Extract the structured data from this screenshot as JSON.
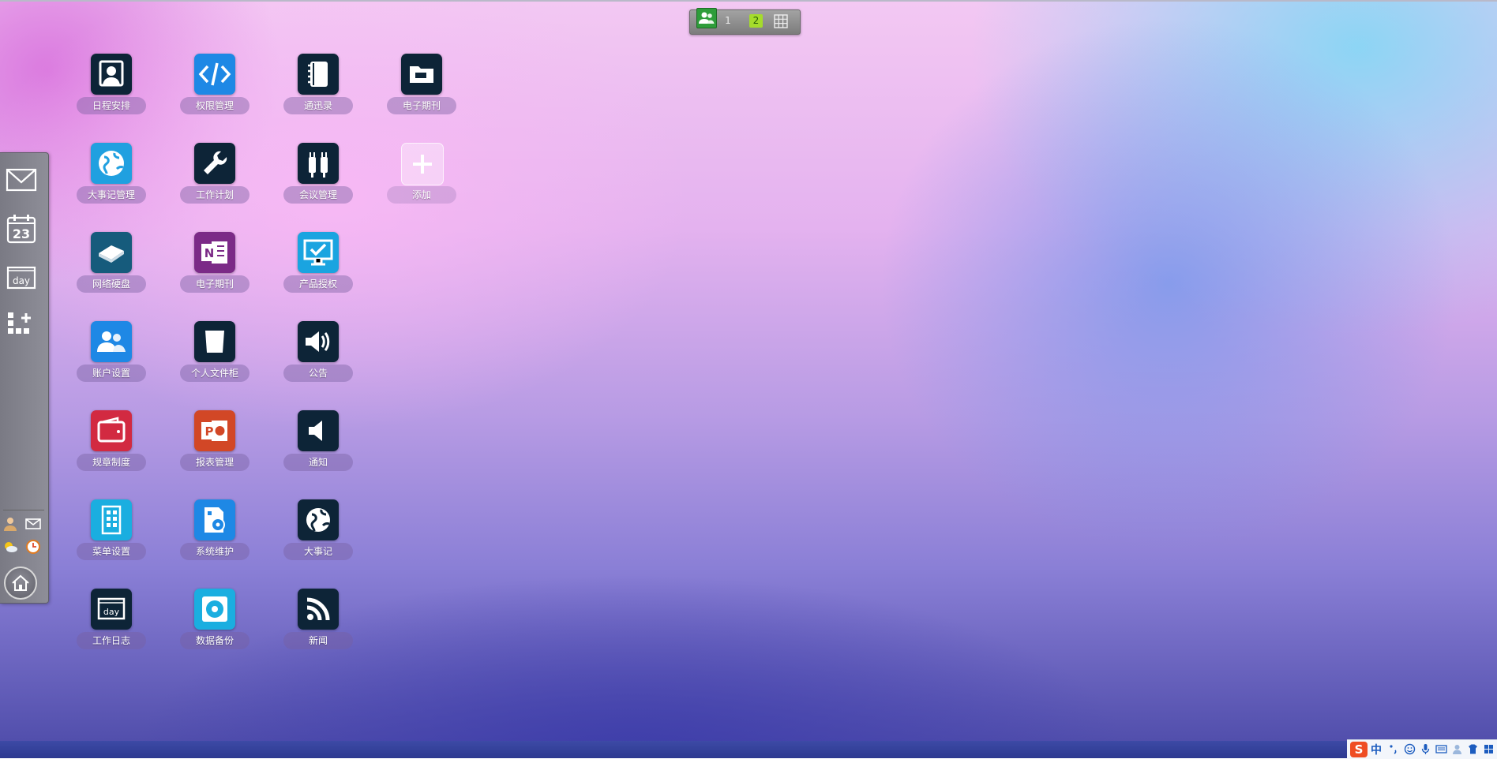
{
  "switcher": {
    "pages": [
      "1",
      "2"
    ],
    "active_page": "2"
  },
  "apps": [
    {
      "label": "日程安排",
      "icon": "schedule-icon",
      "color": "#0d2437"
    },
    {
      "label": "权限管理",
      "icon": "code-icon",
      "color": "#1e88e5"
    },
    {
      "label": "通迅录",
      "icon": "address-book-icon",
      "color": "#0d2437"
    },
    {
      "label": "电子期刊",
      "icon": "folder-icon",
      "color": "#0d2437"
    },
    {
      "label": "大事记管理",
      "icon": "globe-icon",
      "color": "#20a0e0"
    },
    {
      "label": "工作计划",
      "icon": "wrench-icon",
      "color": "#0d2437"
    },
    {
      "label": "会议管理",
      "icon": "plug-icon",
      "color": "#0d2437"
    },
    {
      "label": "添加",
      "icon": "add-icon",
      "color": "#ffffff"
    },
    {
      "label": "网络硬盘",
      "icon": "disk-icon",
      "color": "#165b7c"
    },
    {
      "label": "电子期刊",
      "icon": "onenote-icon",
      "color": "#7b2a87"
    },
    {
      "label": "产品授权",
      "icon": "monitor-check-icon",
      "color": "#1aa4e0"
    },
    {
      "label": "账户设置",
      "icon": "users-icon",
      "color": "#1e88e5"
    },
    {
      "label": "个人文件柜",
      "icon": "document-icon",
      "color": "#0d2437"
    },
    {
      "label": "公告",
      "icon": "speaker-icon",
      "color": "#0d2437"
    },
    {
      "label": "规章制度",
      "icon": "wallet-icon",
      "color": "#d22a41"
    },
    {
      "label": "报表管理",
      "icon": "powerpoint-icon",
      "color": "#d24726"
    },
    {
      "label": "通知",
      "icon": "speaker-mute-icon",
      "color": "#0d2437"
    },
    {
      "label": "菜单设置",
      "icon": "building-icon",
      "color": "#1aaee0"
    },
    {
      "label": "系统维护",
      "icon": "install-icon",
      "color": "#1e88e5"
    },
    {
      "label": "大事记",
      "icon": "globe-dark-icon",
      "color": "#0d2437"
    },
    {
      "label": "工作日志",
      "icon": "day-icon",
      "color": "#0d2437"
    },
    {
      "label": "数据备份",
      "icon": "disc-icon",
      "color": "#1aaee0"
    },
    {
      "label": "新闻",
      "icon": "rss-icon",
      "color": "#0d2437"
    }
  ],
  "dock": {
    "items": [
      "mail-icon",
      "calendar-icon",
      "day-icon",
      "add-apps-icon"
    ],
    "calendar_day": "23",
    "day_text": "day"
  },
  "ime": {
    "logo": "S",
    "lang": "中"
  }
}
